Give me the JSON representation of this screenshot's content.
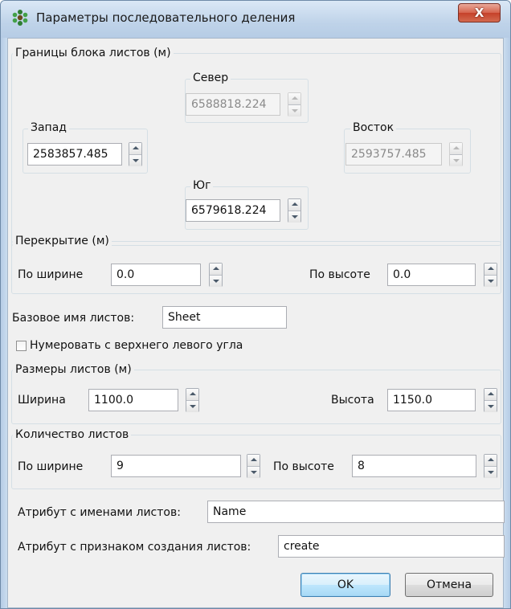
{
  "window": {
    "title": "Параметры последовательного деления",
    "close_glyph": "X",
    "icon": "app-cluster-icon"
  },
  "bounds": {
    "legend": "Границы блока листов (м)",
    "north": {
      "label": "Север",
      "value": "6588818.224",
      "enabled": false
    },
    "west": {
      "label": "Запад",
      "value": "2583857.485",
      "enabled": true
    },
    "east": {
      "label": "Восток",
      "value": "2593757.485",
      "enabled": false
    },
    "south": {
      "label": "Юг",
      "value": "6579618.224",
      "enabled": true
    }
  },
  "overlap": {
    "legend": "Перекрытие (м)",
    "width_label": "По ширине",
    "width_value": "0.0",
    "height_label": "По высоте",
    "height_value": "0.0"
  },
  "base_name": {
    "label": "Базовое имя листов:",
    "value": "Sheet"
  },
  "numbering": {
    "label": "Нумеровать с верхнего левого угла",
    "checked": false
  },
  "sheet_size": {
    "legend": "Размеры листов (м)",
    "width_label": "Ширина",
    "width_value": "1100.0",
    "height_label": "Высота",
    "height_value": "1150.0"
  },
  "sheet_count": {
    "legend": "Количество листов",
    "width_label": "По ширине",
    "width_value": "9",
    "height_label": "По высоте",
    "height_value": "8"
  },
  "name_attribute": {
    "label": "Атрибут с именами листов:",
    "value": "Name"
  },
  "create_attribute": {
    "label": "Атрибут с признаком создания листов:",
    "value": "create"
  },
  "buttons": {
    "ok": "OK",
    "cancel": "Отмена"
  },
  "colors": {
    "title_bar": "#c4d8ee",
    "close_button": "#c9452c",
    "default_button_border": "#3c7fb1"
  }
}
